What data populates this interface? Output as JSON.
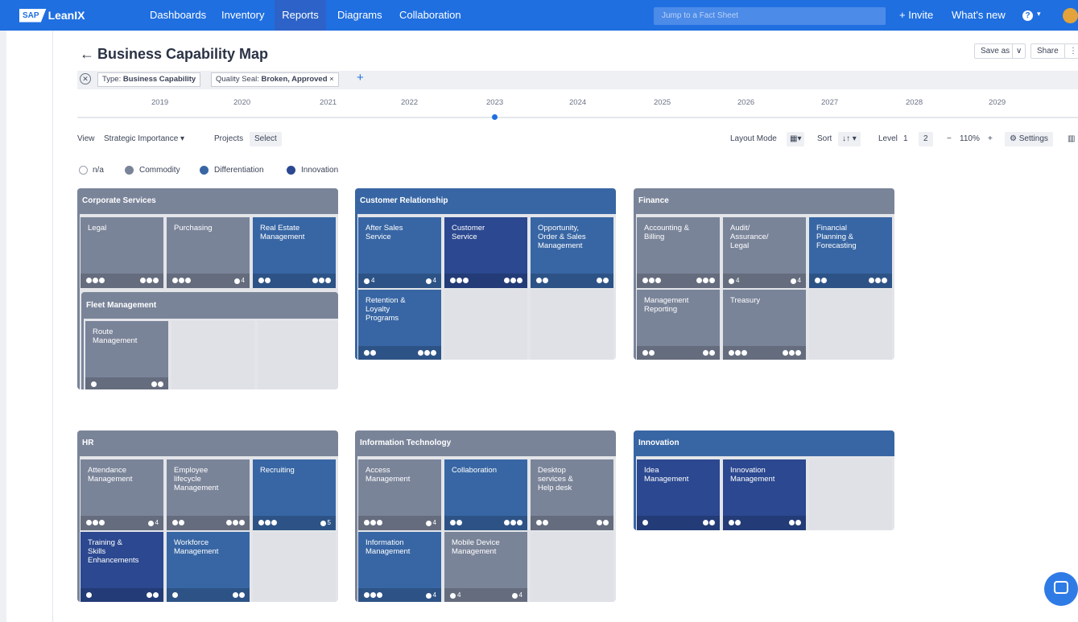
{
  "nav": {
    "brand_logo": "SAP",
    "brand_name": "LeanIX",
    "items": [
      "Dashboards",
      "Inventory",
      "Reports",
      "Diagrams",
      "Collaboration"
    ],
    "active": "Reports",
    "search_placeholder": "Jump to a Fact Sheet",
    "invite": "+ Invite",
    "whats_new": "What's new",
    "help": "?",
    "help_caret": "▾"
  },
  "header": {
    "back": "←",
    "title": "Business Capability Map",
    "save_as": "Save as",
    "save_caret": "∨",
    "share": "Share",
    "more": "⋮"
  },
  "filters": {
    "clear": "✕",
    "chip1_label": "Type:",
    "chip1_value": "Business Capability",
    "chip2_label": "Quality Seal:",
    "chip2_value": "Broken, Approved",
    "chip2_close": "×",
    "add": "+"
  },
  "timeline": {
    "years": [
      "2019",
      "2020",
      "2021",
      "2022",
      "2023",
      "2024",
      "2025",
      "2026",
      "2027",
      "2028",
      "2029"
    ],
    "selected": "2023"
  },
  "toolbar": {
    "view_label": "View",
    "view_value": "Strategic Importance",
    "view_caret": "▾",
    "projects_label": "Projects",
    "projects_value": "Select",
    "layout_label": "Layout Mode",
    "layout_icon": "▦▾",
    "sort_label": "Sort",
    "sort_icon": "↓↑ ▾",
    "level_label": "Level",
    "level_1": "1",
    "level_2": "2",
    "zoom_minus": "−",
    "zoom_value": "110%",
    "zoom_plus": "+",
    "settings": "⚙ Settings",
    "table_icon": "▥"
  },
  "legend": [
    {
      "label": "n/a",
      "color": "#ffffff"
    },
    {
      "label": "Commodity",
      "color": "#7a8499"
    },
    {
      "label": "Differentiation",
      "color": "#3866a4"
    },
    {
      "label": "Innovation",
      "color": "#2b4890"
    }
  ],
  "colors": {
    "nav": "#1f6fe0",
    "commodity": "#7a8499",
    "differentiation": "#3866a4",
    "innovation": "#2b4890",
    "empty": "#e3e5e9"
  },
  "groups": [
    {
      "name": "Corporate Services",
      "cells": [
        {
          "name": "Legal",
          "left": [
            3,
            ""
          ],
          "right": [
            3,
            ""
          ]
        },
        {
          "name": "Purchasing",
          "left": [
            3,
            ""
          ],
          "right": [
            1,
            "4"
          ]
        },
        {
          "name": "Real Estate\nManagement",
          "left": [
            2,
            ""
          ],
          "right": [
            3,
            ""
          ]
        }
      ],
      "sub": {
        "name": "Fleet Management",
        "cells": [
          {
            "name": "Route\nManagement",
            "left": [
              1,
              ""
            ],
            "right": [
              2,
              ""
            ]
          }
        ]
      }
    },
    {
      "name": "Customer Relationship",
      "cells": [
        {
          "name": "After Sales\nService",
          "left": [
            1,
            "4"
          ],
          "right": [
            1,
            "4"
          ]
        },
        {
          "name": "Customer\nService",
          "left": [
            3,
            ""
          ],
          "right": [
            3,
            ""
          ]
        },
        {
          "name": "Opportunity,\nOrder & Sales\nManagement",
          "left": [
            2,
            ""
          ],
          "right": [
            2,
            ""
          ]
        },
        {
          "name": "Retention &\nLoyalty\nPrograms",
          "left": [
            2,
            ""
          ],
          "right": [
            3,
            ""
          ]
        }
      ]
    },
    {
      "name": "Finance",
      "cells": [
        {
          "name": "Accounting &\nBilling",
          "left": [
            3,
            ""
          ],
          "right": [
            3,
            ""
          ]
        },
        {
          "name": "Audit/\nAssurance/\nLegal",
          "left": [
            1,
            "4"
          ],
          "right": [
            1,
            "4"
          ]
        },
        {
          "name": "Financial\nPlanning &\nForecasting",
          "left": [
            2,
            ""
          ],
          "right": [
            3,
            ""
          ]
        },
        {
          "name": "Management\nReporting",
          "left": [
            2,
            ""
          ],
          "right": [
            2,
            ""
          ]
        },
        {
          "name": "Treasury",
          "left": [
            3,
            ""
          ],
          "right": [
            3,
            ""
          ]
        }
      ]
    },
    {
      "name": "HR",
      "cells": [
        {
          "name": "Attendance\nManagement",
          "left": [
            3,
            ""
          ],
          "right": [
            1,
            "4"
          ]
        },
        {
          "name": "Employee\nlifecycle\nManagement",
          "left": [
            2,
            ""
          ],
          "right": [
            3,
            ""
          ]
        },
        {
          "name": "Recruiting",
          "left": [
            3,
            ""
          ],
          "right": [
            1,
            "5"
          ]
        },
        {
          "name": "Training &\nSkills\nEnhancements",
          "left": [
            1,
            ""
          ],
          "right": [
            2,
            ""
          ]
        },
        {
          "name": "Workforce\nManagement",
          "left": [
            1,
            ""
          ],
          "right": [
            2,
            ""
          ]
        }
      ]
    },
    {
      "name": "Information Technology",
      "cells": [
        {
          "name": "Access\nManagement",
          "left": [
            3,
            ""
          ],
          "right": [
            1,
            "4"
          ]
        },
        {
          "name": "Collaboration",
          "left": [
            2,
            ""
          ],
          "right": [
            3,
            ""
          ]
        },
        {
          "name": "Desktop\nservices &\nHelp desk",
          "left": [
            2,
            ""
          ],
          "right": [
            2,
            ""
          ]
        },
        {
          "name": "Information\nManagement",
          "left": [
            3,
            ""
          ],
          "right": [
            1,
            "4"
          ]
        },
        {
          "name": "Mobile Device\nManagement",
          "left": [
            1,
            "4"
          ],
          "right": [
            1,
            "4"
          ]
        }
      ]
    },
    {
      "name": "Innovation",
      "cells": [
        {
          "name": "Idea\nManagement",
          "left": [
            1,
            ""
          ],
          "right": [
            2,
            ""
          ]
        },
        {
          "name": "Innovation\nManagement",
          "left": [
            2,
            ""
          ],
          "right": [
            2,
            ""
          ]
        }
      ]
    }
  ]
}
